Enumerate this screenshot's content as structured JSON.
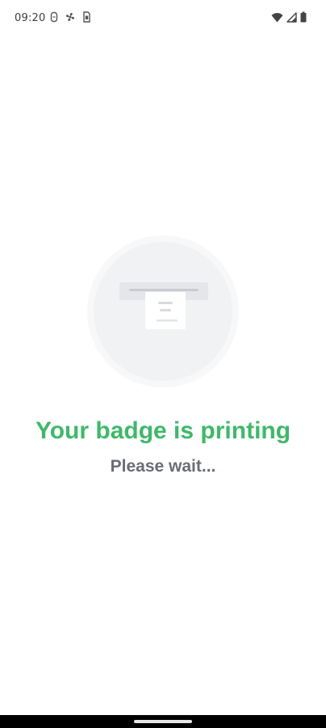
{
  "status_bar": {
    "time": "09:20",
    "left_icons": [
      "sim-icon",
      "fan-icon",
      "sim-card-icon"
    ],
    "right_icons": [
      "wifi-icon",
      "cellular-signal-icon",
      "battery-icon"
    ]
  },
  "illustration": {
    "icon": "printer-badge-icon"
  },
  "message": {
    "title": "Your badge is printing",
    "subtitle": "Please wait..."
  },
  "colors": {
    "title": "#3fb86a",
    "subtitle": "#6a6d76",
    "illustration_bg": "#f2f3f5",
    "background": "#ffffff"
  }
}
